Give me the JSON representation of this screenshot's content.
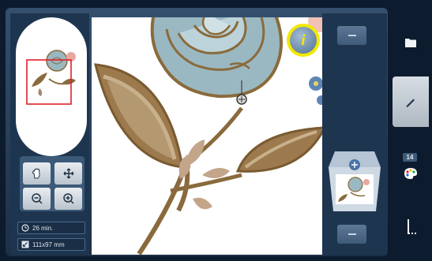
{
  "status": {
    "time_value": "26 min.",
    "size_value": "111x97 mm"
  },
  "colors": {
    "accent_yellow": "#f3e800",
    "selection_frame": "#e0212b",
    "panel_dark": "#1e3550",
    "rose_blue": "#9ab8c1",
    "stitch_brown": "#8a6a3c"
  },
  "icons": {
    "hand": "hand-pan-icon",
    "move": "move-arrows-icon",
    "zoom_out": "zoom-out-icon",
    "zoom_in": "zoom-in-icon",
    "clock": "clock-icon",
    "size": "resize-icon",
    "info": "info-icon",
    "folder": "folder-icon",
    "edit": "pencil-icon",
    "palette": "color-palette-icon",
    "stitch": "stitch-icon"
  },
  "sidebar": {
    "color_count": "14"
  },
  "info_button": {
    "glyph": "i"
  }
}
